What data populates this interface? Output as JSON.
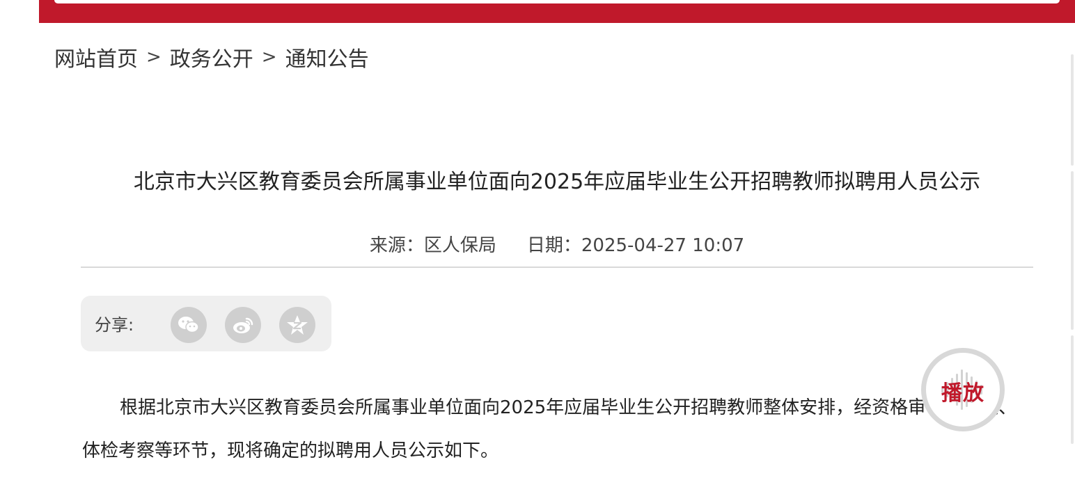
{
  "colors": {
    "brand_red": "#c0192b",
    "share_bg": "#efefef",
    "icon_gray": "#cfcfcf"
  },
  "breadcrumb": {
    "items": [
      "网站首页",
      "政务公开",
      "通知公告"
    ],
    "separator": ">"
  },
  "article": {
    "title": "北京市大兴区教育委员会所属事业单位面向2025年应届毕业生公开招聘教师拟聘用人员公示",
    "source_label": "来源：",
    "source_value": "区人保局",
    "date_label": "日期：",
    "date_value": "2025-04-27 10:07",
    "body": "根据北京市大兴区教育委员会所属事业单位面向2025年应届毕业生公开招聘教师整体安排，经资格审核、考核、体检考察等环节，现将确定的拟聘用人员公示如下。"
  },
  "share": {
    "label": "分享:",
    "icons": [
      "wechat-icon",
      "weibo-icon",
      "qzone-icon"
    ]
  },
  "player": {
    "label": "播放",
    "icon": "sound-wave-icon"
  }
}
